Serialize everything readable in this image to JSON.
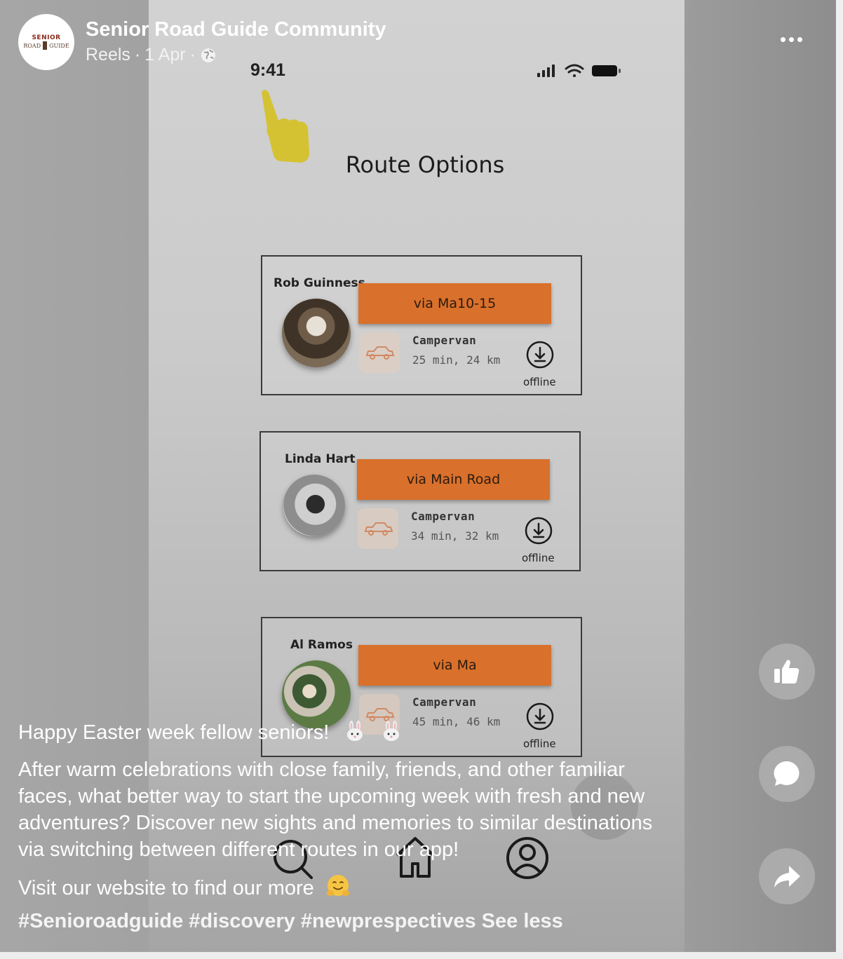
{
  "header": {
    "page_name": "Senior Road Guide Community",
    "meta_reels": "Reels",
    "meta_date": "1 Apr",
    "separator": "·",
    "logo": {
      "top_text": "SENIOR",
      "left_text": "ROAD",
      "right_text": "GUIDE"
    }
  },
  "phone": {
    "status_time": "9:41",
    "title": "Route Options",
    "routes": [
      {
        "name": "Rob Guinness",
        "route_label": "via Ma10-15",
        "vehicle": "Campervan",
        "eta": "25 min, 24 km",
        "offline_label": "offline"
      },
      {
        "name": "Linda Hart",
        "route_label": "via Main Road",
        "vehicle": "Campervan",
        "eta": "34 min, 32 km",
        "offline_label": "offline"
      },
      {
        "name": "Al Ramos",
        "route_label": "via Ma",
        "vehicle": "Campervan",
        "eta": "45 min, 46 km",
        "offline_label": "offline"
      }
    ],
    "tab_icons": [
      "search-icon",
      "home-icon",
      "profile-icon"
    ],
    "accent_color": "#d9702b"
  },
  "caption": {
    "line1": "Happy Easter week fellow seniors!",
    "paragraph": [
      "After warm celebrations with close family, friends, and other familiar",
      "faces, what better way to start the upcoming week with fresh and new",
      "adventures? Discover new sights and memories to similar destinations",
      "via switching between different routes in our app!"
    ],
    "website_line": "Visit our website to find our more",
    "hashtags": [
      "#Senioroadguide",
      "#discovery",
      "#newprespectives"
    ],
    "see_less": "See less",
    "emojis": [
      "bunny-emoji",
      "bunny-emoji",
      "hugging-face-emoji"
    ]
  },
  "actions": [
    "like-icon",
    "comment-icon",
    "share-icon"
  ]
}
